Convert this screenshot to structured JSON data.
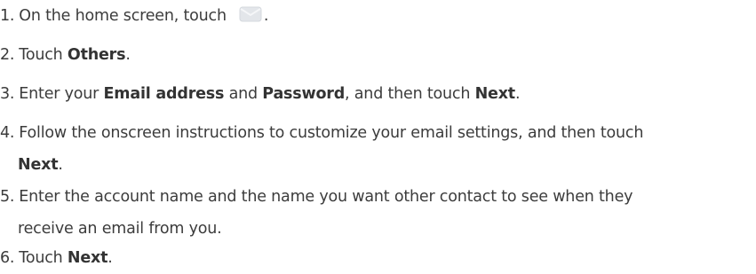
{
  "steps": [
    {
      "num": "1.",
      "text": "On the home screen, touch",
      "icon": "mail-icon",
      "after": "."
    },
    {
      "num": "2.",
      "pre": "Touch ",
      "bold": "Others",
      "post": "."
    },
    {
      "num": "3.",
      "pre": "Enter your ",
      "bold1": "Email address",
      "mid1": " and ",
      "bold2": "Password",
      "mid2": ", and then touch ",
      "bold3": "Next",
      "post": "."
    },
    {
      "num": "4.",
      "text": "Follow the onscreen instructions to customize your email settings, and then touch",
      "bold_cont": "Next",
      "post": "."
    },
    {
      "num": "5.",
      "text": "Enter the account name and the name you want other contact to see when they",
      "cont": "receive an email from you."
    },
    {
      "num": "6.",
      "pre": "Touch ",
      "bold": "Next",
      "post": "."
    }
  ],
  "colors": {
    "text": "#3c3c3c",
    "icon_fill": "#e3e6ea",
    "icon_stroke": "#cfd3d8"
  }
}
